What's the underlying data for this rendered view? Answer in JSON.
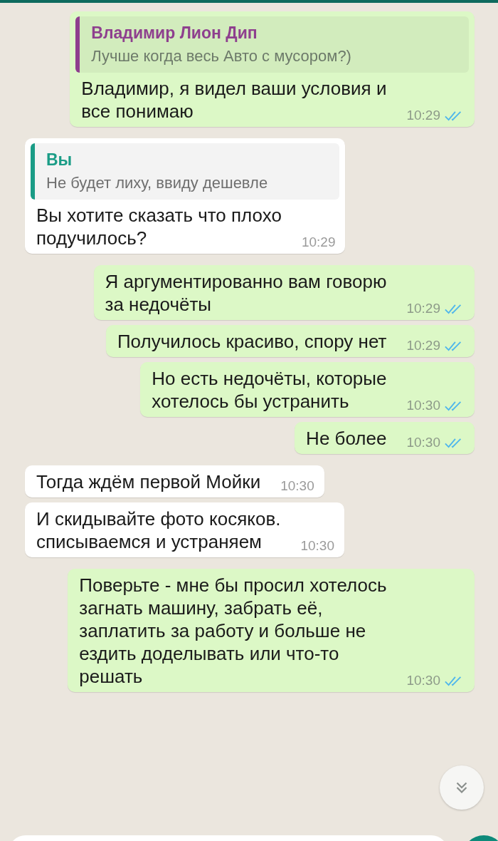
{
  "messages": [
    {
      "kind": "outgoing",
      "quote": {
        "author": "Владимир Лион Дип",
        "text": "Лучше когда весь Авто с мусором?)",
        "kind": "contact"
      },
      "text": "Владимир, я видел ваши условия и\nвсе понимаю",
      "time": "10:29",
      "read": true
    },
    {
      "kind": "incoming",
      "quote": {
        "author": "Вы",
        "text": "Не будет лиху, ввиду дешевле",
        "kind": "self"
      },
      "text": "Вы хотите сказать что плохо\nподучилось?",
      "time": "10:29"
    },
    {
      "kind": "outgoing",
      "text": "Я аргументированно вам говорю\nза недочёты",
      "time": "10:29",
      "read": true
    },
    {
      "kind": "outgoing",
      "text": "Получилось красиво, спору нет",
      "time": "10:29",
      "read": true
    },
    {
      "kind": "outgoing",
      "text": "Но есть недочёты, которые\nхотелось бы устранить",
      "time": "10:30",
      "read": true
    },
    {
      "kind": "outgoing",
      "text": "Не более",
      "time": "10:30",
      "read": true
    },
    {
      "kind": "incoming",
      "text": "Тогда ждём первой Мойки",
      "time": "10:30"
    },
    {
      "kind": "incoming",
      "text": "И скидывайте фото косяков.\nсписываемся и устраняем",
      "time": "10:30"
    },
    {
      "kind": "outgoing",
      "text": "Поверьте - мне бы просил хотелось\nзагнать машину, забрать её,\nзаплатить за работу и больше не\nездить доделывать или что-то\nрешать",
      "time": "10:30",
      "read": true
    }
  ]
}
